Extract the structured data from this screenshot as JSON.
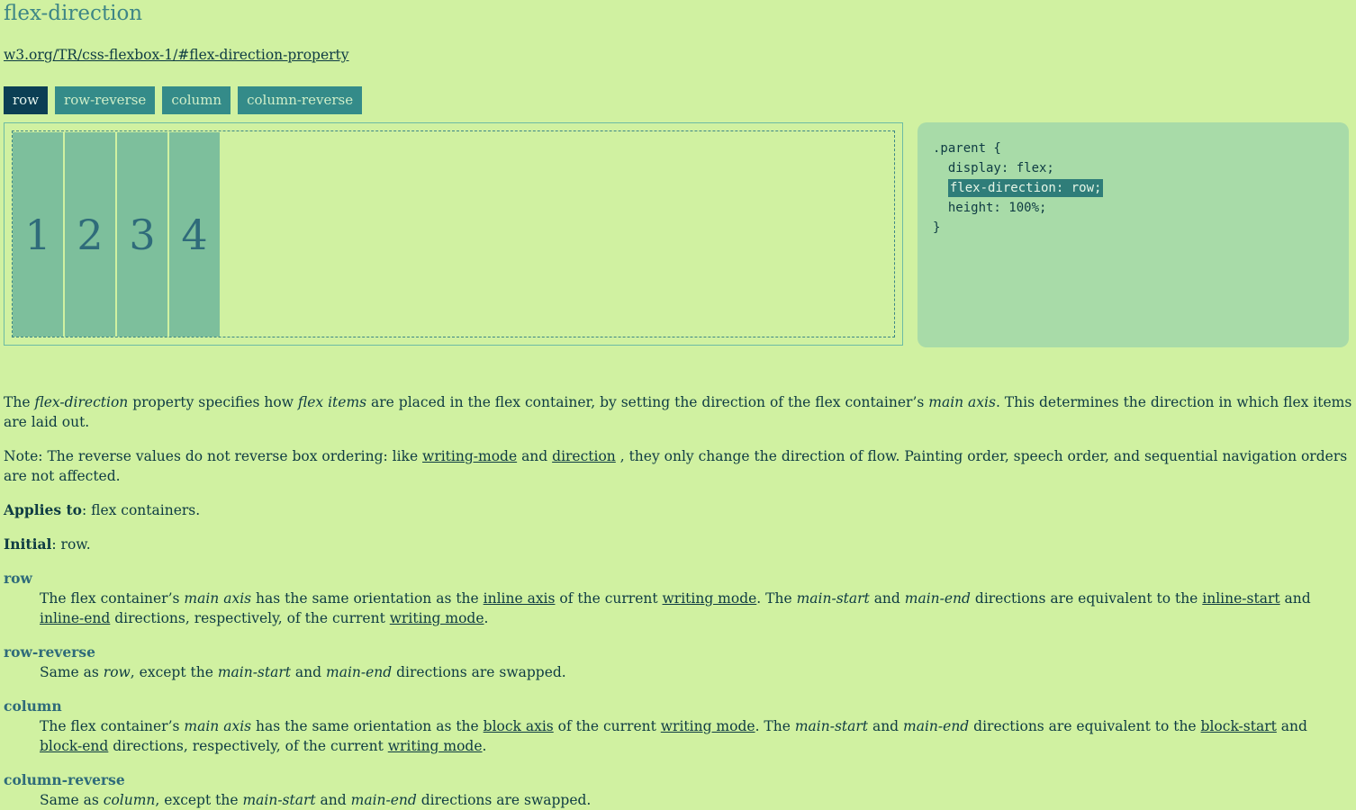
{
  "title": "flex-direction",
  "spec_link": "w3.org/TR/css-flexbox-1/#flex-direction-property",
  "buttons": [
    "row",
    "row-reverse",
    "column",
    "column-reverse"
  ],
  "active_button": "row",
  "items": [
    "1",
    "2",
    "3",
    "4"
  ],
  "code": {
    "line1": ".parent {",
    "line2": "  display: flex;",
    "line3_indent": "  ",
    "line3_highlight": "flex-direction: row;",
    "line4": "  height: 100%;",
    "line5": "}"
  },
  "desc": {
    "p1_a": "The ",
    "p1_em1": "flex-direction",
    "p1_b": " property specifies how ",
    "p1_em2": "flex items",
    "p1_c": " are placed in the flex container, by setting the direction of the flex container’s ",
    "p1_em3": "main axis",
    "p1_d": ". This determines the direction in which flex items are laid out.",
    "p2_a": "Note: The reverse values do not reverse box ordering: like ",
    "p2_link1": "writing-mode",
    "p2_b": " and ",
    "p2_link2": "direction",
    "p2_c": " , they only change the direction of flow. Painting order, speech order, and sequential navigation orders are not affected.",
    "applies_label": "Applies to",
    "applies_value": ": flex containers.",
    "initial_label": "Initial",
    "initial_value": ": row."
  },
  "defs": {
    "row_term": "row",
    "row_a": "The flex container’s ",
    "row_em1": "main axis",
    "row_b": " has the same orientation as the ",
    "row_link1": "inline axis",
    "row_c": " of the current ",
    "row_link2": "writing mode",
    "row_d": ". The ",
    "row_em2": "main-start",
    "row_e": " and ",
    "row_em3": "main-end",
    "row_f": " directions are equivalent to the ",
    "row_link3": "inline-start",
    "row_g": " and ",
    "row_link4": "inline-end",
    "row_h": " directions, respectively, of the current ",
    "row_link5": "writing mode",
    "row_i": ".",
    "rr_term": "row-reverse",
    "rr_a": "Same as ",
    "rr_em1": "row",
    "rr_b": ", except the ",
    "rr_em2": "main-start",
    "rr_c": " and ",
    "rr_em3": "main-end",
    "rr_d": " directions are swapped.",
    "col_term": "column",
    "col_a": "The flex container’s ",
    "col_em1": "main axis",
    "col_b": " has the same orientation as the ",
    "col_link1": "block axis",
    "col_c": " of the current ",
    "col_link2": "writing mode",
    "col_d": ". The ",
    "col_em2": "main-start",
    "col_e": " and ",
    "col_em3": "main-end",
    "col_f": " directions are equivalent to the ",
    "col_link3": "block-start",
    "col_g": " and ",
    "col_link4": "block-end",
    "col_h": " directions, respectively, of the current ",
    "col_link5": "writing mode",
    "col_i": ".",
    "cr_term": "column-reverse",
    "cr_a": "Same as ",
    "cr_em1": "column",
    "cr_b": ", except the ",
    "cr_em2": "main-start",
    "cr_c": " and ",
    "cr_em3": "main-end",
    "cr_d": " directions are swapped."
  }
}
